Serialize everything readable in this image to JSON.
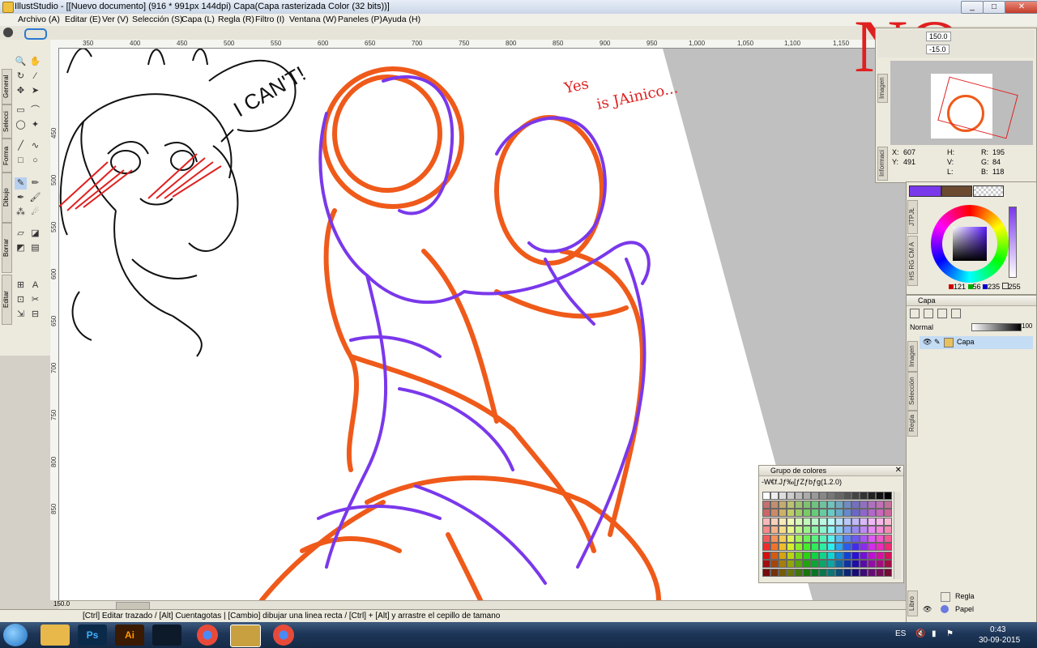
{
  "window": {
    "title": "IllustStudio - [[Nuevo documento] (916 * 991px 144dpi)  Capa(Capa rasterizada Color (32 bits))]",
    "minimize": "_",
    "maximize": "□",
    "close": "✕"
  },
  "menu": [
    "Archivo (A)",
    "Editar (E)",
    "Ver (V)",
    "Selección (S)",
    "Capa (L)",
    "Regla (R)",
    "Filtro (I)",
    "Ventana (W)",
    "Paneles (P)",
    "Ayuda (H)"
  ],
  "ruler_top": [
    "350",
    "400",
    "450",
    "500",
    "550",
    "600",
    "650",
    "700",
    "750",
    "800",
    "850",
    "900",
    "950",
    "1,000",
    "1,050",
    "1,100",
    "1,150"
  ],
  "ruler_left": [
    "450",
    "500",
    "550",
    "600",
    "650",
    "700",
    "750",
    "800",
    "850"
  ],
  "toolbox_tabs": [
    "General",
    "Selecci",
    "Forma",
    "Dibujo",
    "Borrar",
    "Editar"
  ],
  "zoom_display": "150.0",
  "navigator": {
    "tab": "Imagen",
    "zoom_value": "150.0",
    "rotate_value": "-15.0"
  },
  "info": {
    "tab": "Informaci",
    "x_label": "X:",
    "x_value": "607",
    "y_label": "Y:",
    "y_value": "491",
    "h_label": "H:",
    "v_label": "V:",
    "l_label": "L:",
    "r_label": "R:",
    "r_value": "195",
    "g_label": "G:",
    "g_value": "84",
    "b_label": "B:",
    "b_value": "118"
  },
  "color_panel": {
    "tab_top": "JTPJŁ",
    "tab_bottom": "HS RG CM A",
    "r": "121",
    "g": "56",
    "b": "235",
    "a": "255",
    "main_color": "#7a38eb",
    "sub_color": "#6b4a30"
  },
  "layers": {
    "title": "Capa",
    "blend_mode": "Normal",
    "opacity": "100",
    "tabs": [
      "Imagen",
      "Selección",
      "Regla"
    ],
    "items": [
      {
        "name": "Capa"
      }
    ],
    "bottom_tab": "Libro",
    "bottom_items": [
      {
        "name": "Regla"
      },
      {
        "name": "Papel"
      }
    ]
  },
  "color_set": {
    "title": "Grupo de colores",
    "set_name": "-W€f.Jƒ‰[ƒZƒbƒg(1.2.0)"
  },
  "canvas_annotations": {
    "no_text": "NO",
    "yes_text": "Yes",
    "is_text": "is JAinico...",
    "icant_text": "I CAN'T!"
  },
  "zoom_bottom": "150.0",
  "status": "[Ctrl] Editar trazado / [Alt] Cuentagotas | [Cambio] dibujar una linea recta / [Ctrl] + [Alt] y arrastre el cepillo de tamano",
  "taskbar": {
    "apps": [
      "Ps",
      "Ai"
    ],
    "lang": "ES",
    "time": "0:43",
    "date": "30-09-2015"
  },
  "colors": {
    "orange": "#ef5a1a",
    "purple": "#7a38eb",
    "red": "#e02020"
  }
}
